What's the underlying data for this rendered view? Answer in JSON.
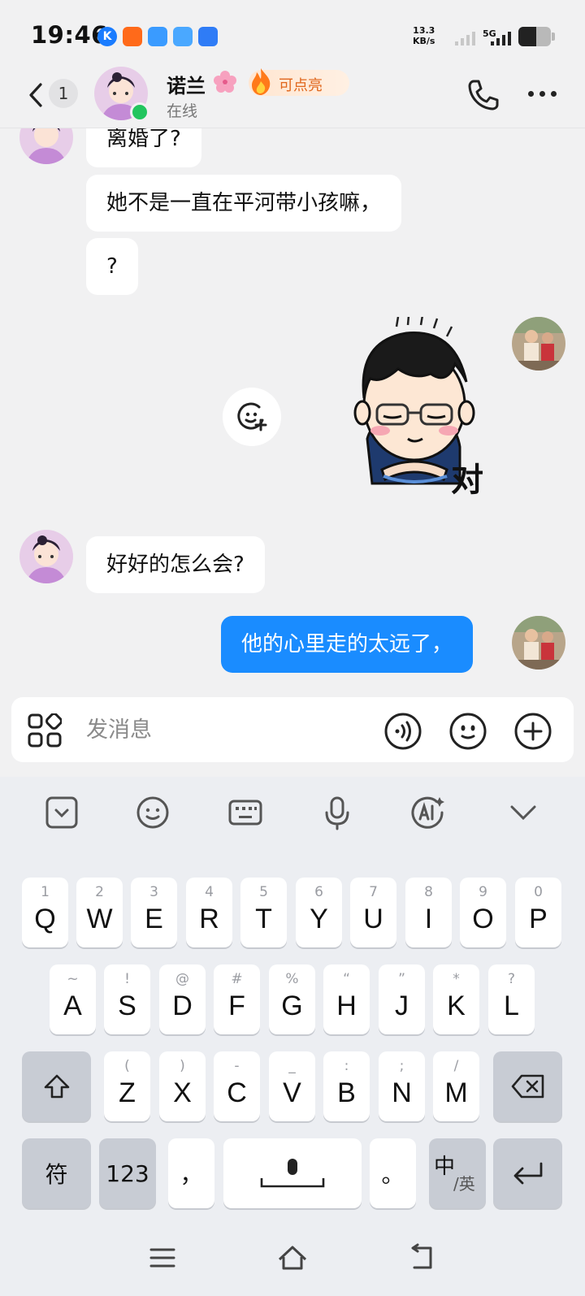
{
  "status_bar": {
    "time": "19:46",
    "net_speed": "13.3",
    "net_unit": "KB/s",
    "network_type": "5G",
    "app_icons": [
      "K",
      "",
      "",
      "",
      ""
    ],
    "app_icon_colors": [
      "#1a7cff",
      "#ff6a1a",
      "#3a9bff",
      "#4aa8ff",
      "#2f7cf6"
    ]
  },
  "header": {
    "unread_count": "1",
    "contact_name": "诺兰",
    "contact_status": "在线",
    "spark_label": "可点亮"
  },
  "messages": [
    {
      "side": "left",
      "text": "离婚了?"
    },
    {
      "side": "left",
      "text": "她不是一直在平河带小孩嘛，"
    },
    {
      "side": "left",
      "text": "?"
    },
    {
      "side": "right",
      "type": "sticker",
      "caption": "对"
    },
    {
      "side": "left",
      "text": "好好的怎么会?"
    },
    {
      "side": "right",
      "text": "他的心里走的太远了，"
    }
  ],
  "input": {
    "placeholder": "发消息"
  },
  "keyboard": {
    "row1": [
      {
        "main": "Q",
        "sub": "1"
      },
      {
        "main": "W",
        "sub": "2"
      },
      {
        "main": "E",
        "sub": "3"
      },
      {
        "main": "R",
        "sub": "4"
      },
      {
        "main": "T",
        "sub": "5"
      },
      {
        "main": "Y",
        "sub": "6"
      },
      {
        "main": "U",
        "sub": "7"
      },
      {
        "main": "I",
        "sub": "8"
      },
      {
        "main": "O",
        "sub": "9"
      },
      {
        "main": "P",
        "sub": "0"
      }
    ],
    "row2": [
      {
        "main": "A",
        "sub": "~"
      },
      {
        "main": "S",
        "sub": "!"
      },
      {
        "main": "D",
        "sub": "@"
      },
      {
        "main": "F",
        "sub": "#"
      },
      {
        "main": "G",
        "sub": "%"
      },
      {
        "main": "H",
        "sub": "“"
      },
      {
        "main": "J",
        "sub": "”"
      },
      {
        "main": "K",
        "sub": "*"
      },
      {
        "main": "L",
        "sub": "?"
      }
    ],
    "row3": [
      {
        "main": "Z",
        "sub": "("
      },
      {
        "main": "X",
        "sub": ")"
      },
      {
        "main": "C",
        "sub": "-"
      },
      {
        "main": "V",
        "sub": "_"
      },
      {
        "main": "B",
        "sub": ":"
      },
      {
        "main": "N",
        "sub": ";"
      },
      {
        "main": "M",
        "sub": "/"
      }
    ],
    "symbols_label": "符",
    "numbers_label": "123",
    "comma_label": "，",
    "period_label": "。",
    "lang_main": "中",
    "lang_sub": "/英"
  },
  "colors": {
    "accent": "#1a8cff",
    "online": "#22c55e",
    "spark": "#e0661c"
  }
}
